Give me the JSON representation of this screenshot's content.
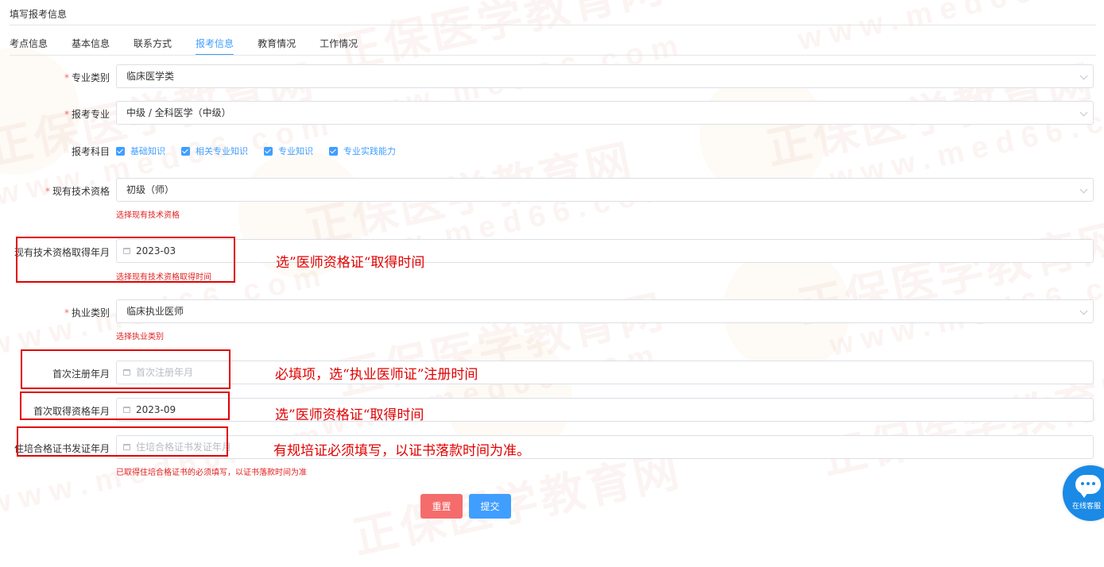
{
  "page": {
    "title": "填写报考信息"
  },
  "tabs": [
    {
      "label": "考点信息"
    },
    {
      "label": "基本信息"
    },
    {
      "label": "联系方式"
    },
    {
      "label": "报考信息",
      "active": true
    },
    {
      "label": "教育情况"
    },
    {
      "label": "工作情况"
    }
  ],
  "form": {
    "major_category": {
      "label": "专业类别",
      "value": "临床医学类"
    },
    "major": {
      "label": "报考专业",
      "value": "中级 / 全科医学（中级）"
    },
    "subjects": {
      "label": "报考科目",
      "options": [
        {
          "label": "基础知识",
          "checked": true
        },
        {
          "label": "相关专业知识",
          "checked": true
        },
        {
          "label": "专业知识",
          "checked": true
        },
        {
          "label": "专业实践能力",
          "checked": true
        }
      ]
    },
    "current_qualification": {
      "label": "现有技术资格",
      "value": "初级（师）",
      "error": "选择现有技术资格"
    },
    "qualification_date": {
      "label": "现有技术资格取得年月",
      "value": "2023-03",
      "error": "选择现有技术资格取得时间"
    },
    "practice_category": {
      "label": "执业类别",
      "value": "临床执业医师",
      "error": "选择执业类别"
    },
    "first_registration": {
      "label": "首次注册年月",
      "placeholder": "首次注册年月"
    },
    "first_qualification": {
      "label": "首次取得资格年月",
      "value": "2023-09"
    },
    "residency_cert_date": {
      "label": "住培合格证书发证年月",
      "placeholder": "住培合格证书发证年月",
      "error": "已取得住培合格证书的必须填写，以证书落款时间为准"
    }
  },
  "annotations": {
    "note1": "选”医师资格证“取得时间",
    "note2": "必填项，选“执业医师证”注册时间",
    "note3": "选”医师资格证“取得时间",
    "note4": "有规培证必须填写，以证书落款时间为准。"
  },
  "buttons": {
    "reset": "重置",
    "submit": "提交"
  },
  "watermark": {
    "cn": "正保医学教育网",
    "en": "www.med66.com"
  },
  "widget": {
    "label": "在线客服"
  },
  "colors": {
    "primary": "#409eff",
    "danger": "#f56c6c",
    "annotation": "#e00000"
  }
}
